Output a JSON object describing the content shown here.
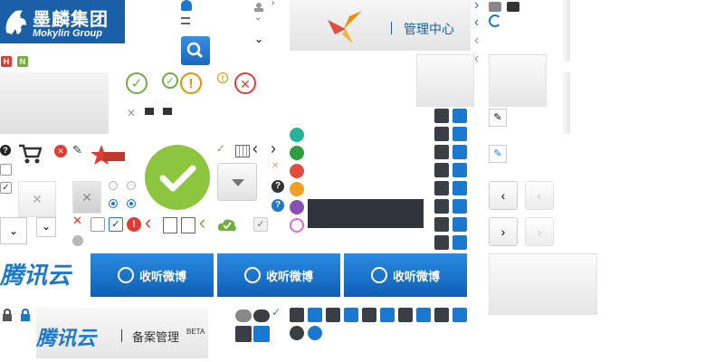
{
  "brand": {
    "mokylin_cn": "墨麟集团",
    "mokylin_en": "Mokylin Group",
    "admin_center": "管理中心",
    "tencent_cloud": "腾讯云",
    "record_management": "备案管理",
    "beta": "BETA"
  },
  "badges": {
    "h": "H",
    "n": "N"
  },
  "weibo_buttons": [
    {
      "label": "收听微博"
    },
    {
      "label": "收听微博"
    },
    {
      "label": "收听微博"
    }
  ],
  "small_icons": {
    "help": "?",
    "close": "✕",
    "warning": "!",
    "check": "✓",
    "chev_right": "›",
    "chev_left": "‹"
  },
  "colors": {
    "brand_blue": "#1a5fa8",
    "tile_dark": "#3a3f46",
    "tile_blue": "#1a78cf",
    "success_green": "#8cc63f",
    "warning_orange": "#f08c00",
    "error_red": "#e03c31",
    "cloud_teal": "#27b29a",
    "cloud_green": "#2e9e3e",
    "cloud_red": "#e04e3c",
    "cloud_orange": "#f0a020",
    "cloud_purple": "#8a4fb5",
    "cloud_pink": "#e06ad0",
    "dark_bar": "#2f343b"
  }
}
